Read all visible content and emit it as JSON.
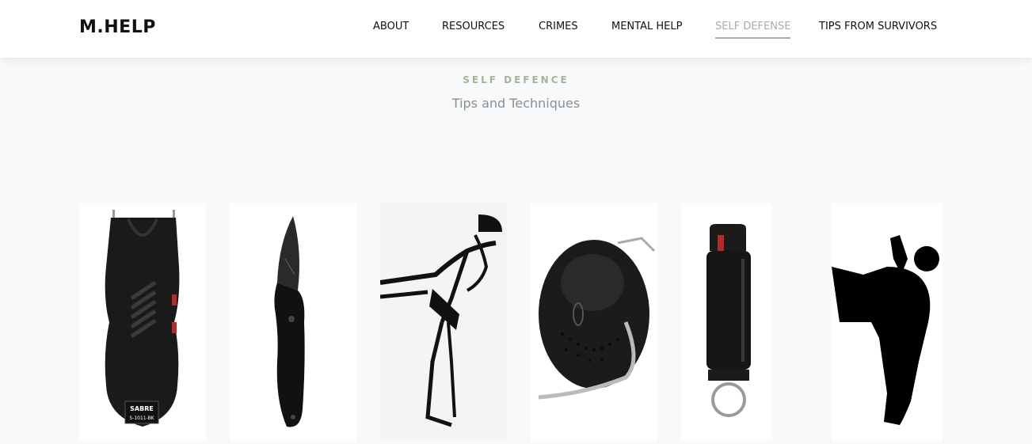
{
  "header": {
    "logo": "M.HELP",
    "nav": [
      {
        "label": "ABOUT"
      },
      {
        "label": "RESOURCES"
      },
      {
        "label": "CRIMES"
      },
      {
        "label": "MENTAL HELP"
      },
      {
        "label": "SELF DEFENSE"
      },
      {
        "label": "TIPS FROM SURVIVORS"
      }
    ],
    "active_label": "SELF DEFENSE"
  },
  "section": {
    "kicker": "SELF DEFENCE",
    "title": "Tips and Techniques"
  },
  "gallery": {
    "items": [
      {
        "icon": "stun-gun-icon",
        "brand": "SABRE",
        "model": "S-1011-BK"
      },
      {
        "icon": "folding-knife-icon"
      },
      {
        "icon": "karate-side-kick-drawing-icon"
      },
      {
        "icon": "personal-alarm-icon"
      },
      {
        "icon": "pepper-spray-icon"
      },
      {
        "icon": "karate-kick-silhouette-icon"
      }
    ]
  },
  "colors": {
    "accent": "#a8b0a0",
    "background": "#f8f9fa",
    "header_bg": "#ffffff",
    "text": "#111111",
    "muted": "#8a8f93"
  }
}
